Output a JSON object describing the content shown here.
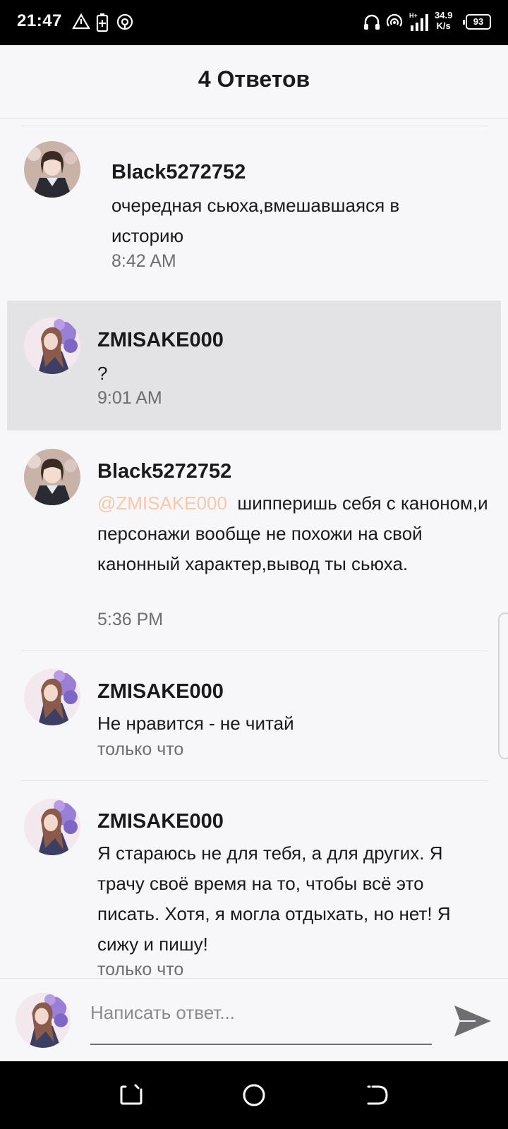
{
  "status_bar": {
    "time": "21:47",
    "net_speed_value": "34.9",
    "net_speed_unit": "K/s",
    "battery": "93"
  },
  "header": {
    "title": "4 Ответов"
  },
  "comments": [
    {
      "author": "Black5272752",
      "text": "очередная сьюха,вмешавшаяся в историю",
      "time": "8:42 AM",
      "avatar": "avatar-dark-hair-girl"
    },
    {
      "author": "ZMISAKE000",
      "text": "?",
      "time": "9:01 AM",
      "avatar": "avatar-purple-flowers-girl",
      "highlighted": true
    },
    {
      "author": "Black5272752",
      "mention": "@ZMISAKE000",
      "text": "шипперишь себя с каноном,и персонажи вообще не похожи на свой канонный характер,вывод ты сьюха.",
      "time": "5:36 PM",
      "avatar": "avatar-dark-hair-girl"
    },
    {
      "author": "ZMISAKE000",
      "text": "Не нравится - не читай",
      "time": "только что",
      "avatar": "avatar-purple-flowers-girl"
    },
    {
      "author": "ZMISAKE000",
      "text": "Я стараюсь не для тебя, а для других. Я трачу своё время на то, чтобы всё это писать. Хотя, я могла отдыхать, но нет! Я сижу и пишу!",
      "time": "только что",
      "avatar": "avatar-purple-flowers-girl"
    }
  ],
  "reply": {
    "placeholder": "Написать ответ...",
    "send_icon": "send-icon"
  },
  "colors": {
    "mention": "#f6c9aa",
    "highlight": "#e3e2e5",
    "background": "#f7f6f9",
    "muted_text": "#6e6e72"
  }
}
